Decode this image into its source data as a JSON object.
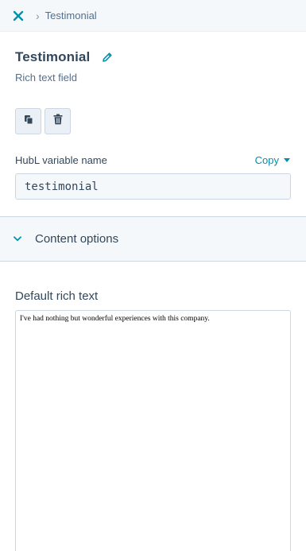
{
  "breadcrumb": {
    "separator": "›",
    "current": "Testimonial"
  },
  "header": {
    "title": "Testimonial",
    "subtitle": "Rich text field"
  },
  "actions": {
    "clone_icon": "clone-icon",
    "delete_icon": "trash-icon"
  },
  "hubl": {
    "label": "HubL variable name",
    "copy_label": "Copy",
    "value": "testimonial"
  },
  "section": {
    "title": "Content options",
    "expanded": false
  },
  "rich_text": {
    "label": "Default rich text",
    "content": "I've had nothing but wonderful experiences with this company."
  },
  "colors": {
    "accent": "#0091ae",
    "text": "#33475b",
    "border": "#cbd6e2",
    "panel": "#f5f8fa"
  }
}
